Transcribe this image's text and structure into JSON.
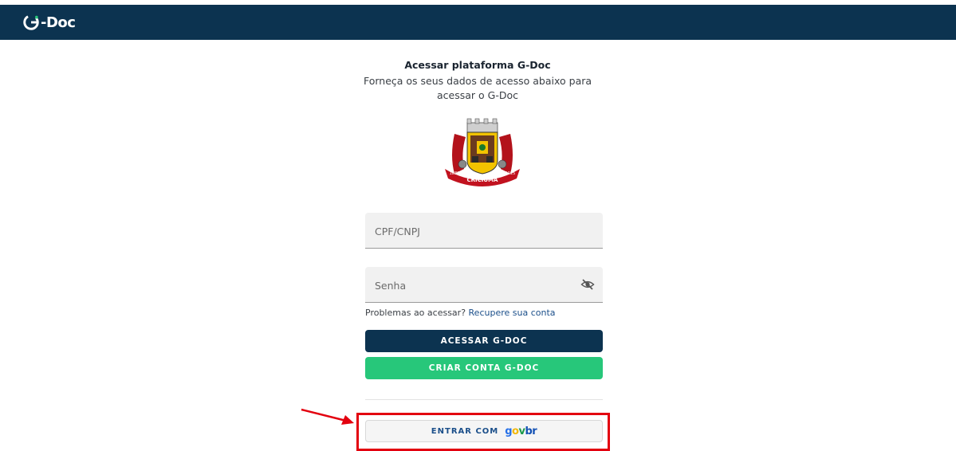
{
  "header": {
    "logo_text": "-Doc"
  },
  "login": {
    "title": "Acessar plataforma G-Doc",
    "subtitle_line1": "Forneça os seus dados de acesso abaixo para",
    "subtitle_line2": "acessar o G-Doc",
    "crest": {
      "text": "CRICIÚMA",
      "year_left": "1880",
      "year_right": "1925"
    },
    "cpf_placeholder": "CPF/CNPJ",
    "password_placeholder": "Senha",
    "help_text": "Problemas ao acessar?",
    "help_link": "Recupere sua conta",
    "access_button": "ACESSAR G-DOC",
    "create_button": "CRIAR CONTA G-DOC",
    "govbr_button": "ENTRAR COM",
    "govbr_logo": {
      "g": "g",
      "o": "o",
      "v": "v",
      "b": "b",
      "r": "r"
    }
  },
  "colors": {
    "primary": "#0c3350",
    "secondary": "#27c77a",
    "highlight": "#e3000f"
  }
}
